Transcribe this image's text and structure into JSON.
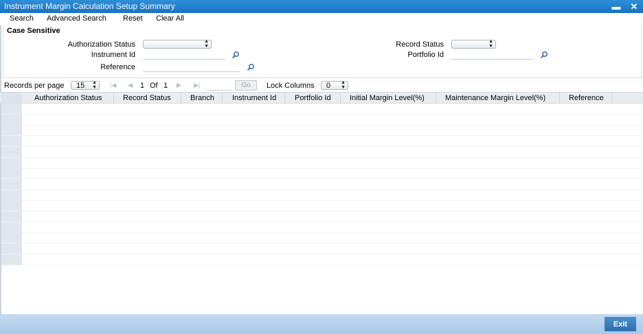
{
  "window": {
    "title": "Instrument Margin Calculation Setup Summary",
    "minimize_glyph": "▬",
    "close_glyph": "✕"
  },
  "menu": {
    "search": "Search",
    "advanced_search": "Advanced Search",
    "reset": "Reset",
    "clear_all": "Clear All"
  },
  "criteria": {
    "case_sensitive": "Case Sensitive",
    "authorization_status_label": "Authorization Status",
    "authorization_status_value": "",
    "record_status_label": "Record Status",
    "record_status_value": "",
    "instrument_id_label": "Instrument Id",
    "instrument_id_value": "",
    "portfolio_id_label": "Portfolio Id",
    "portfolio_id_value": "",
    "reference_label": "Reference",
    "reference_value": ""
  },
  "pager": {
    "records_per_page_label": "Records per page",
    "records_per_page_value": "15",
    "current_page": "1",
    "of_label": "Of",
    "total_pages": "1",
    "go_label": "Go",
    "lock_columns_label": "Lock Columns",
    "lock_columns_value": "0"
  },
  "grid": {
    "columns": [
      "Authorization Status",
      "Record Status",
      "Branch",
      "Instrument Id",
      "Portfolio Id",
      "Initial Margin Level(%)",
      "Maintenance Margin Level(%)",
      "Reference"
    ],
    "empty_rows": 15
  },
  "footer": {
    "exit_label": "Exit"
  },
  "colors": {
    "titlebar": "#1a72c2",
    "footer": "#a9c8e6",
    "exit_button": "#2c6fb0"
  },
  "icons": {
    "lookup": "search-icon",
    "first_page": "first-page-icon",
    "prev_page": "prev-page-icon",
    "next_page": "next-page-icon",
    "last_page": "last-page-icon"
  }
}
